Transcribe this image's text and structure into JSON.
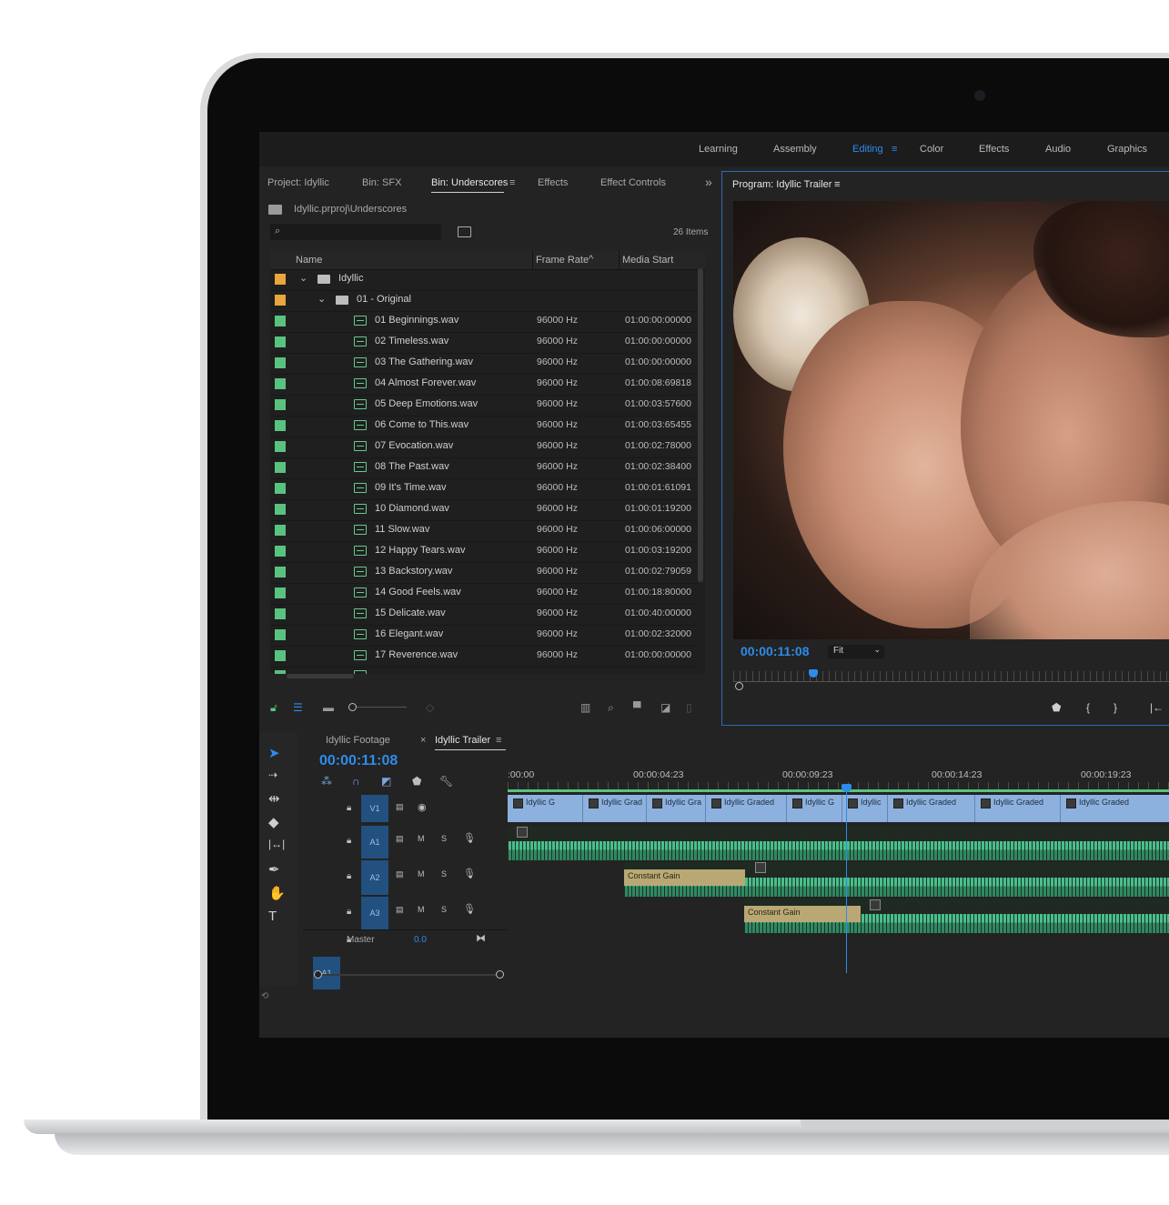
{
  "workspaces": {
    "items": [
      "Learning",
      "Assembly",
      "Editing",
      "Color",
      "Effects",
      "Audio",
      "Graphics"
    ],
    "active": "Editing",
    "menu_glyph": "≡"
  },
  "project_panel": {
    "tabs": [
      "Project: Idyllic",
      "Bin: SFX",
      "Bin: Underscores",
      "Effects",
      "Effect Controls"
    ],
    "active_tab": "Bin: Underscores",
    "overflow": "»",
    "tab_menu_glyph": "≡",
    "path": "Idyllic.prproj\\Underscores",
    "item_count": "26 Items",
    "columns": [
      "Name",
      "Frame Rate",
      "Media Start"
    ],
    "sort_indicator": "^",
    "tree": [
      {
        "label": "Idyllic",
        "color": "#e9a53e",
        "chevron": "⌄"
      },
      {
        "label": "01 - Original",
        "color": "#e9a53e",
        "chevron": "⌄"
      }
    ],
    "rows": [
      {
        "name": "01 Beginnings.wav",
        "rate": "96000 Hz",
        "start": "01:00:00:00000"
      },
      {
        "name": "02 Timeless.wav",
        "rate": "96000 Hz",
        "start": "01:00:00:00000"
      },
      {
        "name": "03 The Gathering.wav",
        "rate": "96000 Hz",
        "start": "01:00:00:00000"
      },
      {
        "name": "04 Almost Forever.wav",
        "rate": "96000 Hz",
        "start": "01:00:08:69818"
      },
      {
        "name": "05 Deep Emotions.wav",
        "rate": "96000 Hz",
        "start": "01:00:03:57600"
      },
      {
        "name": "06 Come to This.wav",
        "rate": "96000 Hz",
        "start": "01:00:03:65455"
      },
      {
        "name": "07 Evocation.wav",
        "rate": "96000 Hz",
        "start": "01:00:02:78000"
      },
      {
        "name": "08 The Past.wav",
        "rate": "96000 Hz",
        "start": "01:00:02:38400"
      },
      {
        "name": "09 It's Time.wav",
        "rate": "96000 Hz",
        "start": "01:00:01:61091"
      },
      {
        "name": "10 Diamond.wav",
        "rate": "96000 Hz",
        "start": "01:00:01:19200"
      },
      {
        "name": "11 Slow.wav",
        "rate": "96000 Hz",
        "start": "01:00:06:00000"
      },
      {
        "name": "12 Happy Tears.wav",
        "rate": "96000 Hz",
        "start": "01:00:03:19200"
      },
      {
        "name": "13 Backstory.wav",
        "rate": "96000 Hz",
        "start": "01:00:02:79059"
      },
      {
        "name": "14 Good Feels.wav",
        "rate": "96000 Hz",
        "start": "01:00:18:80000"
      },
      {
        "name": "15 Delicate.wav",
        "rate": "96000 Hz",
        "start": "01:00:40:00000"
      },
      {
        "name": "16 Elegant.wav",
        "rate": "96000 Hz",
        "start": "01:00:02:32000"
      },
      {
        "name": "17 Reverence.wav",
        "rate": "96000 Hz",
        "start": "01:00:00:00000"
      }
    ],
    "row_color": "#5ac27f"
  },
  "program_monitor": {
    "title": "Program: Idyllic Trailer",
    "menu_glyph": "≡",
    "timecode": "00:00:11:08",
    "zoom": "Fit",
    "zoom_chevron": "⌄"
  },
  "timeline": {
    "tabs": [
      "Idyllic Footage",
      "Idyllic Trailer"
    ],
    "active_tab": "Idyllic Trailer",
    "close_glyph": "×",
    "menu_glyph": "≡",
    "timecode": "00:00:11:08",
    "time_labels": [
      ":00:00",
      "00:00:04:23",
      "00:00:09:23",
      "00:00:14:23",
      "00:00:19:23"
    ],
    "tracks": {
      "v1": "V1",
      "a1": "A1",
      "a2": "A2",
      "a3": "A3",
      "source_a1": "A1",
      "m": "M",
      "s": "S"
    },
    "video_clips": [
      "Idyllic G",
      "Idyllic Grad",
      "Idyllic Gra",
      "Idyllic Graded",
      "Idyllic G",
      "Idyllic",
      "Idyllic Graded",
      "Idyllic Graded",
      "Idyllic Graded"
    ],
    "gain_labels": [
      "Constant Gain",
      "Constant Gain"
    ],
    "master_label": "Master",
    "master_value": "0.0",
    "accent_color": "#2d8ceb",
    "video_clip_color": "#8db1de",
    "audio_color": "#47c08a"
  }
}
